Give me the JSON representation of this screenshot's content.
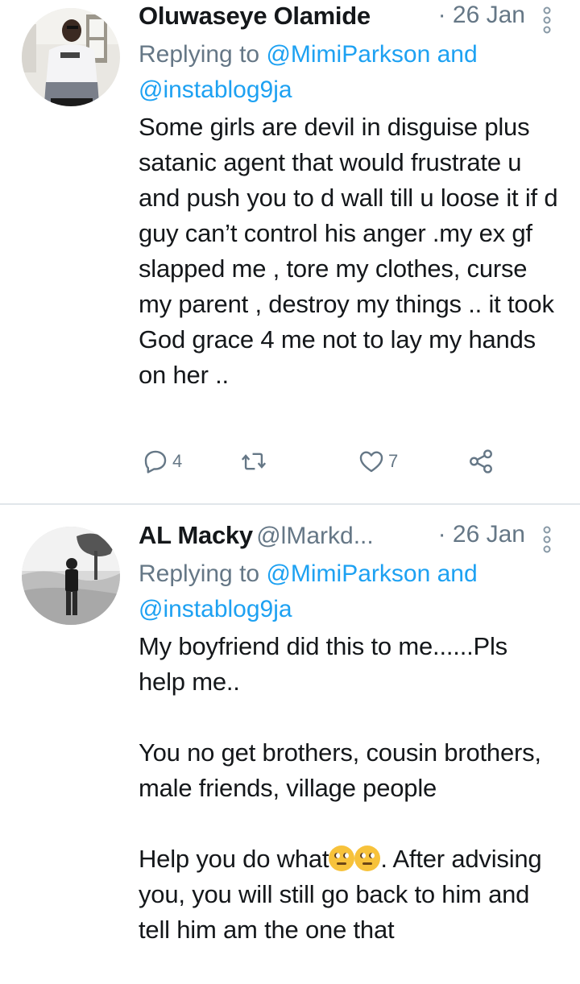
{
  "tweets": [
    {
      "name": "Oluwaseye Olamide",
      "handle": "",
      "date": "· 26 Jan",
      "reply_prefix": "Replying to ",
      "reply_mentions": "@MimiParkson and @instablog9ja",
      "body": "Some girls are devil in disguise plus satanic agent that would frustrate u and push you to d wall till u loose it if d guy can’t control his anger .my ex gf slapped me , tore my clothes, curse my parent , destroy my things .. it took God grace 4 me not to lay my hands on her ..",
      "actions": {
        "reply_count": "4",
        "retweet_count": "",
        "like_count": "7"
      }
    },
    {
      "name": "AL Macky",
      "handle": "@lMarkd...",
      "date": "· 26 Jan",
      "reply_prefix": "Replying to ",
      "reply_mentions": "@MimiParkson and @instablog9ja",
      "body_part1": "My boyfriend did this to me......Pls help me..\n\nYou no get brothers, cousin brothers, male friends, village people\n\nHelp you do what",
      "body_part2": ". After advising you, you will still go back to him and tell him am the one that"
    }
  ],
  "icons": {
    "more": "more-vertical-icon",
    "reply": "reply-icon",
    "retweet": "retweet-icon",
    "like": "heart-icon",
    "share": "share-icon",
    "emoji": "face-with-rolling-eyes-emoji"
  },
  "colors": {
    "link": "#1da1f2",
    "secondary": "#657786",
    "text": "#14171a"
  }
}
